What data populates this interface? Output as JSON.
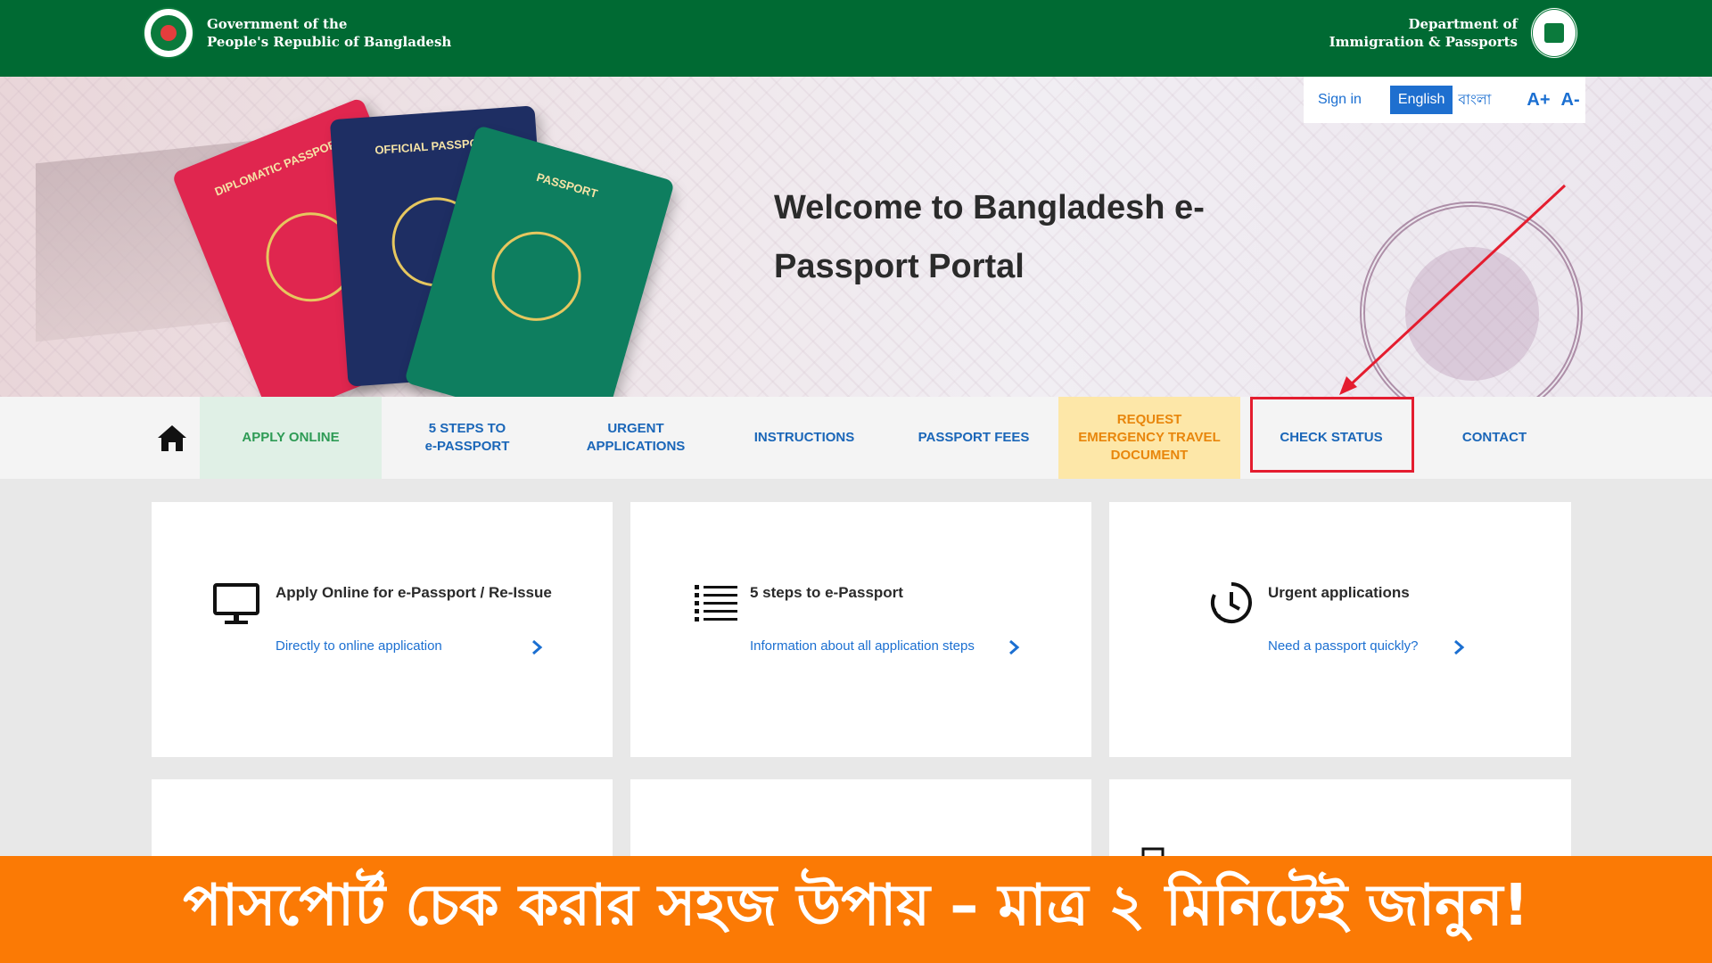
{
  "header": {
    "gov_line1": "Government of the",
    "gov_line2": "People's Republic of Bangladesh",
    "dept_line1": "Department of",
    "dept_line2": "Immigration & Passports"
  },
  "utility": {
    "signin": "Sign in",
    "lang_en": "English",
    "lang_bn": "বাংলা",
    "font_plus": "A+",
    "font_minus": "A-"
  },
  "hero": {
    "title": "Welcome to Bangladesh e-Passport Portal",
    "passports": {
      "red": "DIPLOMATIC PASSPORT",
      "blue": "OFFICIAL PASSPORT",
      "green": "PASSPORT"
    }
  },
  "nav": {
    "apply": "APPLY ONLINE",
    "steps_line1": "5 STEPS TO",
    "steps_line2": "e-PASSPORT",
    "urgent_line1": "URGENT",
    "urgent_line2": "APPLICATIONS",
    "instructions": "INSTRUCTIONS",
    "fees": "PASSPORT FEES",
    "emerg_line1": "REQUEST",
    "emerg_line2": "EMERGENCY TRAVEL",
    "emerg_line3": "DOCUMENT",
    "check": "CHECK STATUS",
    "contact": "CONTACT"
  },
  "cards": [
    {
      "title": "Apply Online for e-Passport / Re-Issue",
      "link": "Directly to online application",
      "icon": "monitor-icon"
    },
    {
      "title": "5 steps to e-Passport",
      "link": "Information about all application steps",
      "icon": "list-icon"
    },
    {
      "title": "Urgent applications",
      "link": "Need a passport quickly?",
      "icon": "clock-icon"
    }
  ],
  "banner": {
    "text": "পাসপোর্ট চেক করার সহজ উপায় – মাত্র ২ মিনিটেই জানুন!"
  },
  "colors": {
    "gov_green": "#006a33",
    "link_blue": "#1b6fd1",
    "apply_green": "#2e9b55",
    "emergency_orange": "#e8860c",
    "highlight_red": "#e41d2f",
    "banner_orange": "#fb7a05"
  }
}
